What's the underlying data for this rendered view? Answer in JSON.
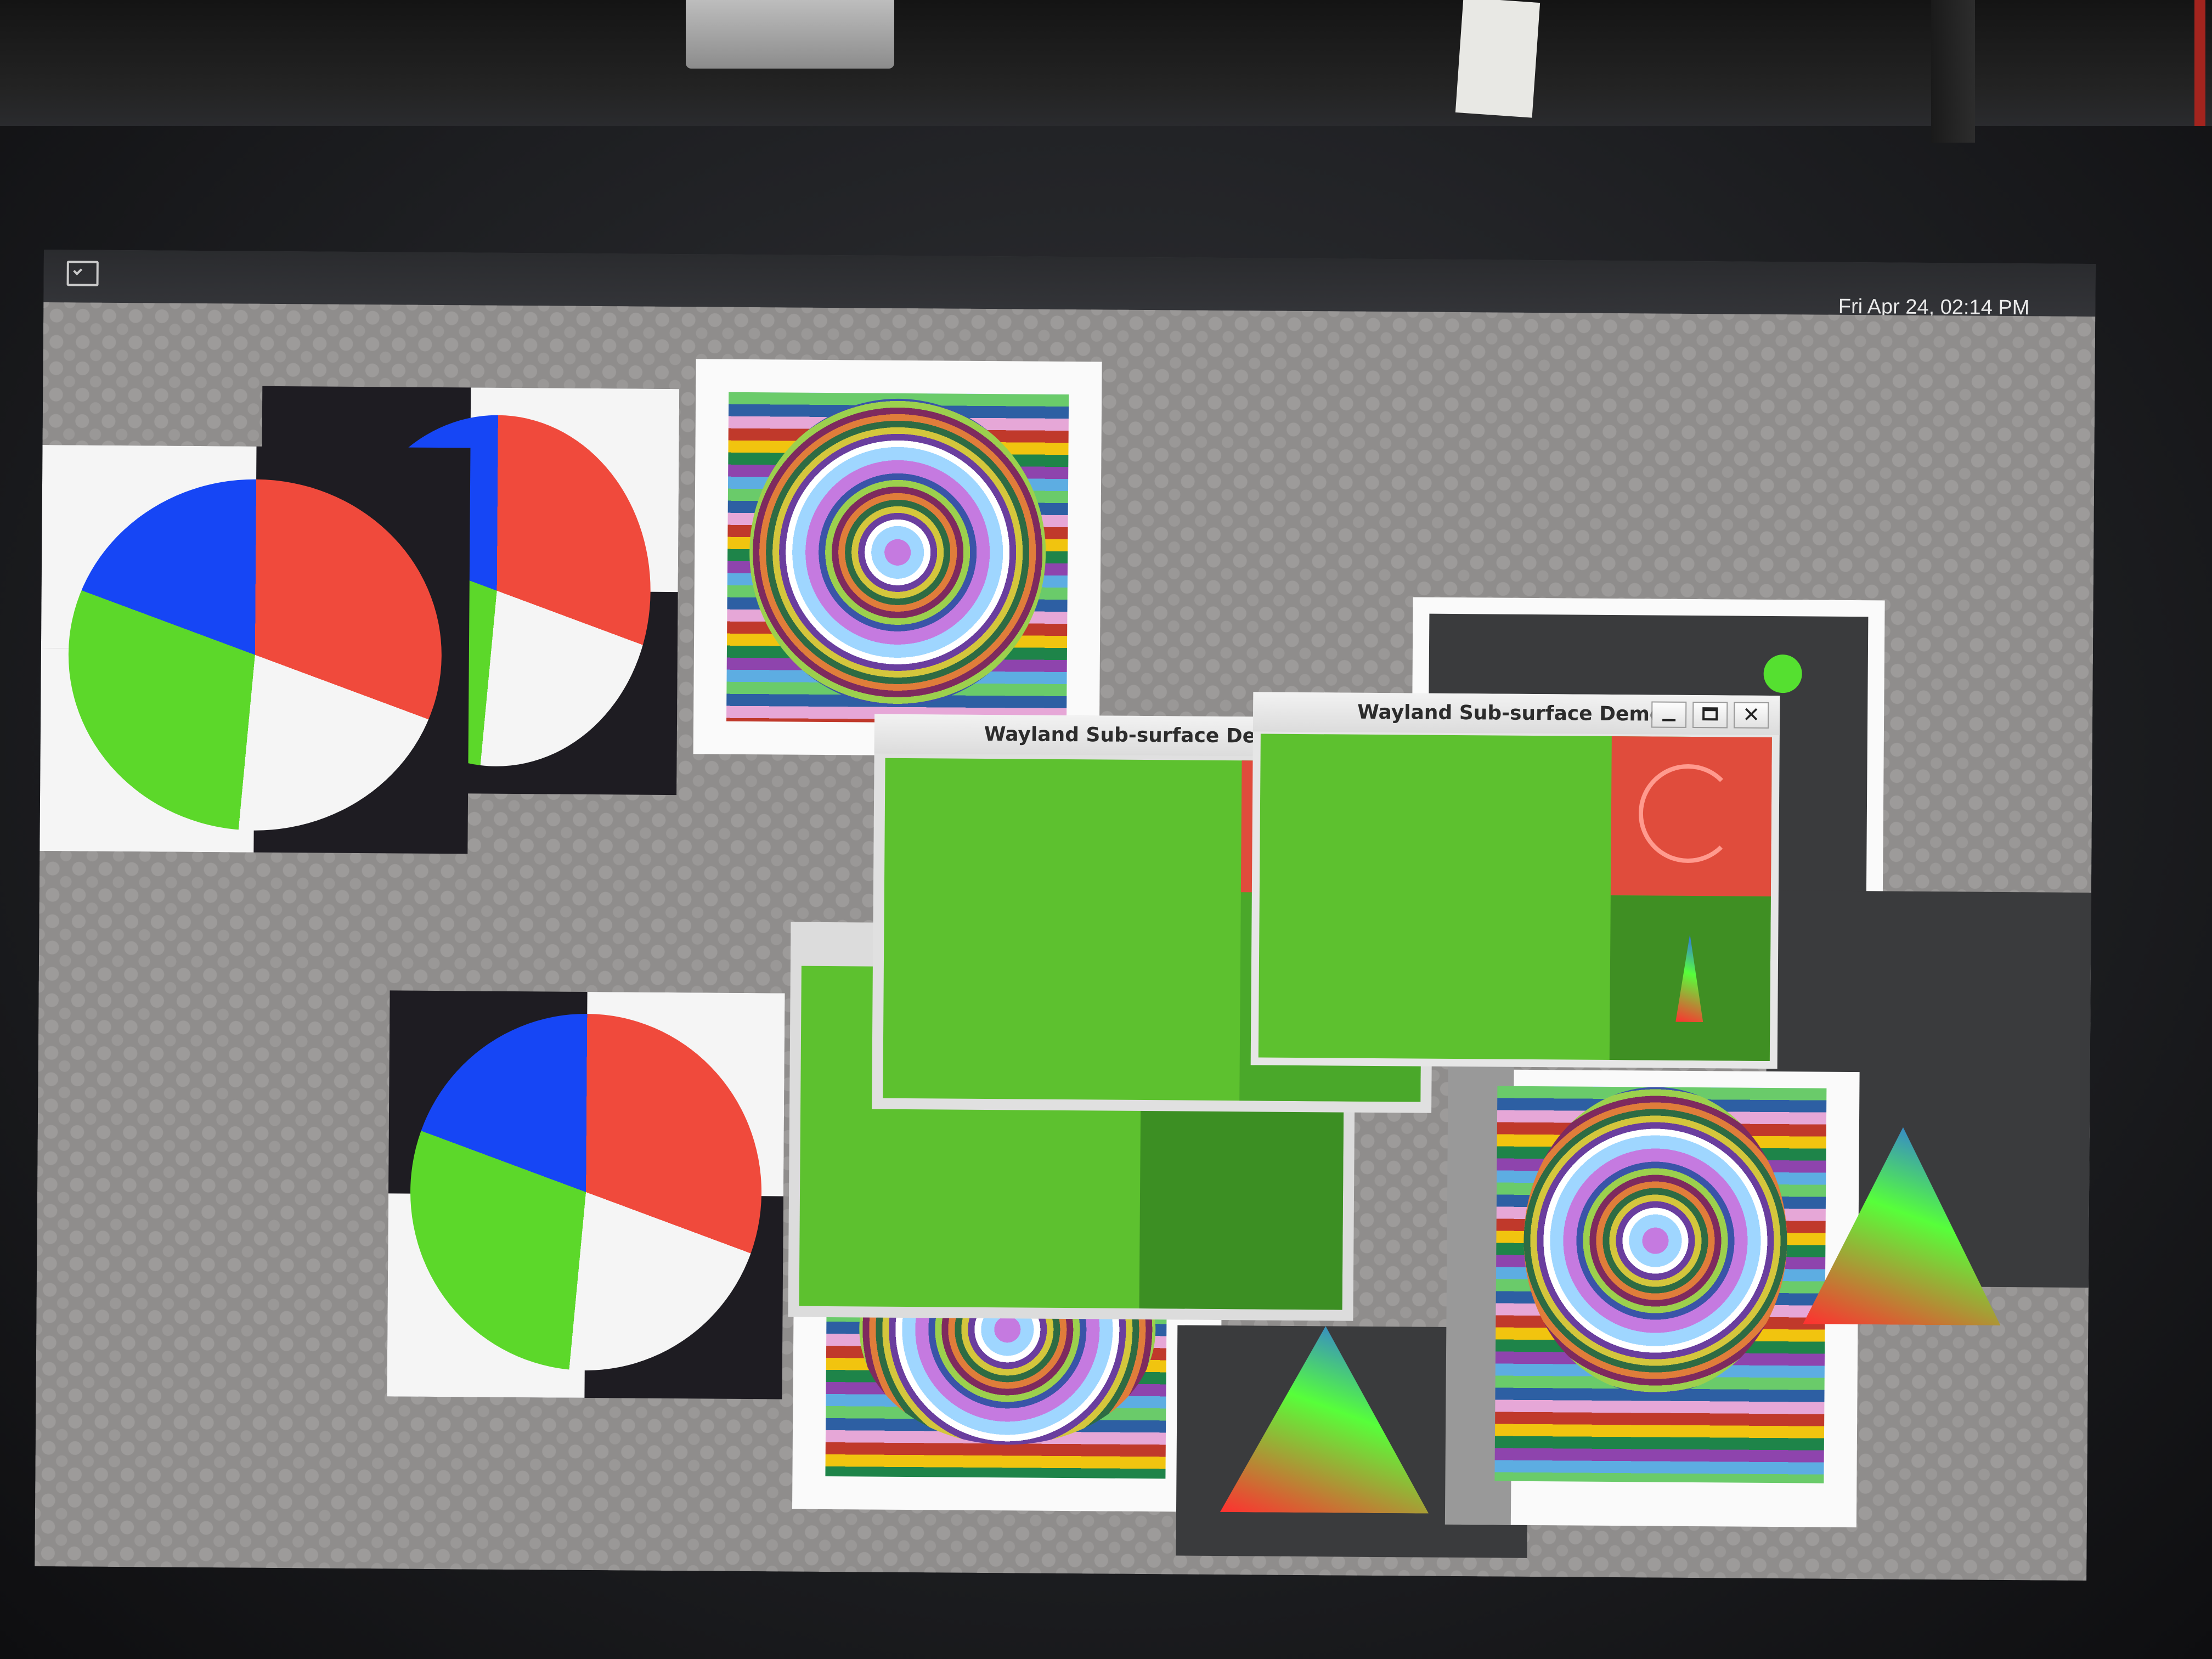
{
  "taskbar": {
    "launcher_icon": "terminal-icon",
    "clock_text": "Fri Apr 24, 02:14 PM"
  },
  "windows": [
    {
      "title": "Wayland Sub-surface Demo"
    },
    {
      "title": "Wayland Sub-surface Demo"
    }
  ],
  "window_controls": {
    "minimize_icon": "minimize-icon",
    "maximize_icon": "maximize-icon",
    "close_label": "✕"
  },
  "colors": {
    "panel": "#2f3033",
    "desktop": "#8f8d8c",
    "demo_green": "#5dc12f",
    "demo_red": "#e04c3c"
  }
}
